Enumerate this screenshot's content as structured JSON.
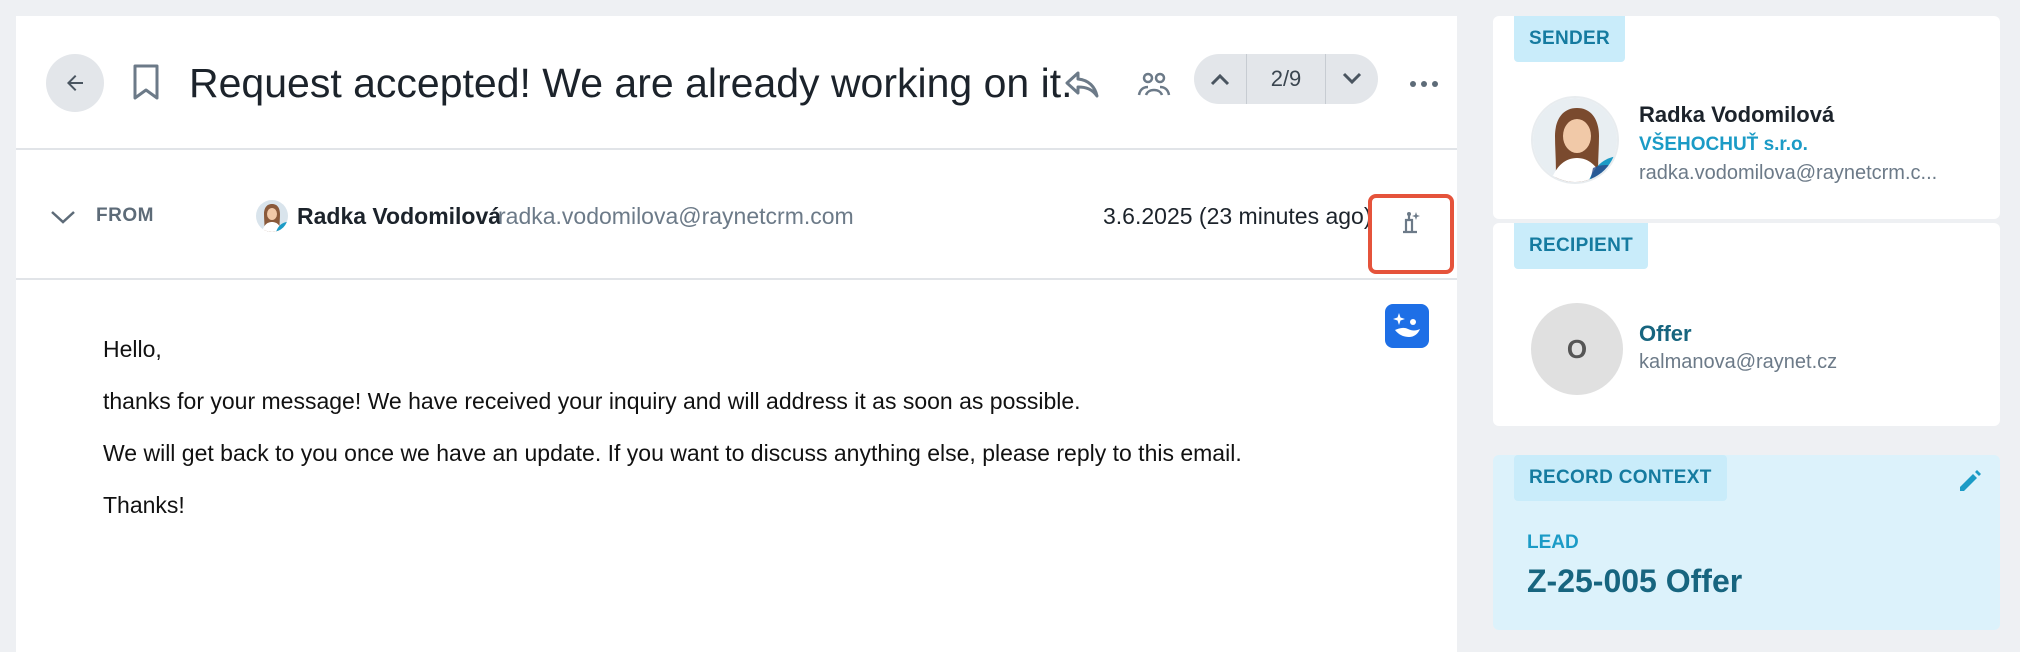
{
  "header": {
    "subject": "Request accepted! We are already working on it.",
    "pager": "2/9"
  },
  "from_row": {
    "label": "FROM",
    "name": "Radka Vodomilová",
    "email": "radka.vodomilova@raynetcrm.com",
    "date": "3.6.2025 (23 minutes ago)"
  },
  "body": {
    "lines": [
      "Hello,",
      "thanks for your message! We have received your inquiry and will address it as soon as possible.",
      "We will get back to you once we have an update. If you want to discuss anything else, please reply to this email.",
      "Thanks!"
    ]
  },
  "sender": {
    "label": "SENDER",
    "name": "Radka Vodomilová",
    "company": "VŠEHOCHUŤ s.r.o.",
    "email": "radka.vodomilova@raynetcrm.c..."
  },
  "recipient": {
    "label": "RECIPIENT",
    "initial": "O",
    "name": "Offer",
    "email": "kalmanova@raynet.cz"
  },
  "record_context": {
    "label": "RECORD CONTEXT",
    "type": "LEAD",
    "title": "Z-25-005 Offer"
  },
  "colors": {
    "accent": "#1b9bc6",
    "highlight": "#e5533b",
    "ai_button": "#1e6fe6",
    "context_bg": "#dcf2fb"
  },
  "icons": [
    "back-arrow-icon",
    "bookmark-icon",
    "reply-icon",
    "group-icon",
    "chevron-up-icon",
    "chevron-down-icon",
    "more-icon",
    "ai-tag-icon",
    "ai-sparkle-icon",
    "pencil-icon"
  ]
}
